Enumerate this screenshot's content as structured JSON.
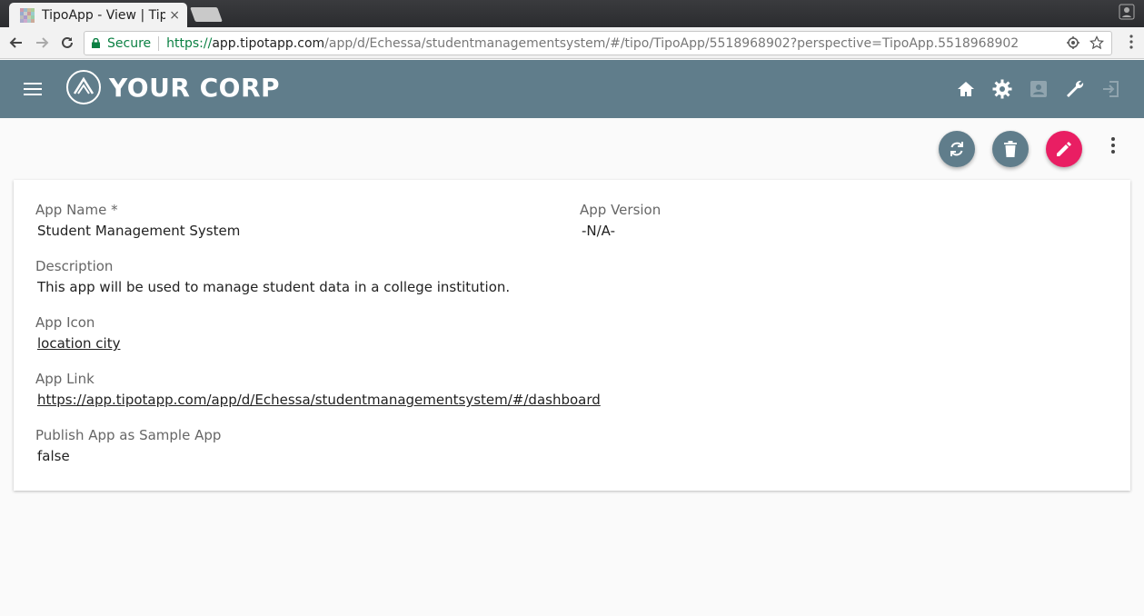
{
  "browser": {
    "tab_title": "TipoApp - View | Tip",
    "tab_close": "×",
    "secure_label": "Secure",
    "url_proto": "https://",
    "url_host": "app.tipotapp.com",
    "url_path": "/app/d/Echessa/studentmanagementsystem/#/tipo/TipoApp/5518968902?perspective=TipoApp.5518968902"
  },
  "header": {
    "brand": "YOUR CORP",
    "bg_color": "#607d8b",
    "icons": [
      "home-icon",
      "settings-icon",
      "account-box-icon",
      "build-icon",
      "exit-icon"
    ]
  },
  "actions": {
    "refresh_color": "#607d8b",
    "delete_color": "#607d8b",
    "edit_color": "#e91e63"
  },
  "record": {
    "app_name_label": "App Name *",
    "app_name_value": "Student Management System",
    "app_version_label": "App Version",
    "app_version_value": "-N/A-",
    "description_label": "Description",
    "description_value": "This app will be used to manage student data in a college institution.",
    "app_icon_label": "App Icon",
    "app_icon_value": "location city",
    "app_link_label": "App Link",
    "app_link_value": "https://app.tipotapp.com/app/d/Echessa/studentmanagementsystem/#/dashboard",
    "publish_label": "Publish App as Sample App",
    "publish_value": "false"
  }
}
